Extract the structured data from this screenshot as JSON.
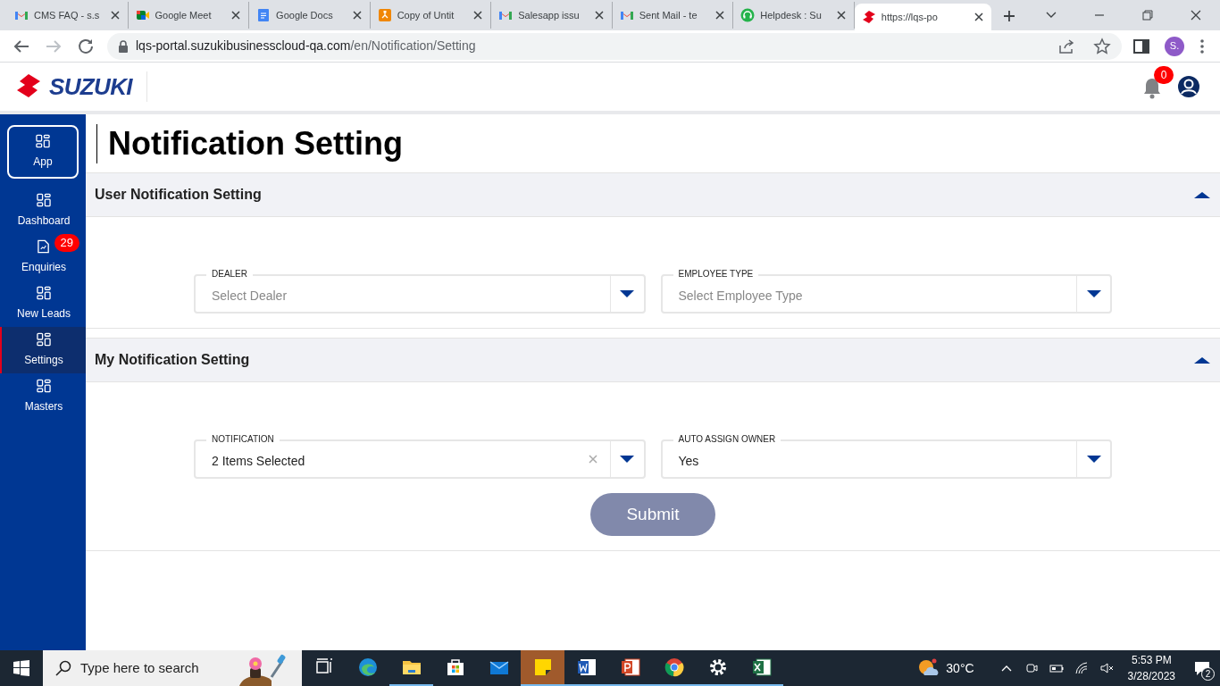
{
  "browser": {
    "tabs": [
      {
        "label": "CMS FAQ - s.s",
        "selected": false
      },
      {
        "label": "Google Meet",
        "selected": false
      },
      {
        "label": "Google Docs",
        "selected": false
      },
      {
        "label": "Copy of Untit",
        "selected": false
      },
      {
        "label": "Salesapp issu",
        "selected": false
      },
      {
        "label": "Sent Mail - te",
        "selected": false
      },
      {
        "label": "Helpdesk : Su",
        "selected": false
      },
      {
        "label": "https://lqs-po",
        "selected": true
      }
    ],
    "url_host": "lqs-portal.suzukibusinesscloud-qa.com",
    "url_path": "/en/Notification/Setting",
    "profile": "S."
  },
  "header": {
    "logo": "SUZUKI",
    "notification_count": "0"
  },
  "sidebar": {
    "items": [
      {
        "label": "App",
        "kind": "boxed",
        "selected": false
      },
      {
        "label": "Dashboard",
        "kind": "link",
        "selected": false
      },
      {
        "label": "Enquiries",
        "kind": "link",
        "selected": false,
        "badge": "29"
      },
      {
        "label": "New Leads",
        "kind": "link",
        "selected": false
      },
      {
        "label": "Settings",
        "kind": "link",
        "selected": true
      },
      {
        "label": "Masters",
        "kind": "link",
        "selected": false
      }
    ]
  },
  "page_title": "Notification Setting",
  "sections": [
    {
      "title": "User Notification Setting",
      "expanded": true,
      "fields": [
        {
          "label": "DEALER",
          "placeholder": "Select Dealer",
          "clearable": false
        },
        {
          "label": "EMPLOYEE TYPE",
          "placeholder": "Select Employee Type",
          "clearable": false
        }
      ]
    },
    {
      "title": "My Notification Setting",
      "expanded": true,
      "fields": [
        {
          "label": "NOTIFICATION",
          "value": "2 Items Selected",
          "clearable": true
        },
        {
          "label": "AUTO ASSIGN OWNER",
          "value": "Yes",
          "clearable": false
        }
      ],
      "submit": {
        "label": "Submit",
        "disabled": true
      }
    }
  ],
  "taskbar": {
    "search_placeholder": "Type here to search",
    "apps": [
      {
        "kind": "taskview",
        "running": false,
        "focused": false
      },
      {
        "kind": "edge",
        "running": false,
        "focused": false
      },
      {
        "kind": "explorer",
        "running": true,
        "focused": false
      },
      {
        "kind": "store",
        "running": false,
        "focused": false
      },
      {
        "kind": "mail",
        "running": false,
        "focused": false
      },
      {
        "kind": "sticky",
        "running": true,
        "focused": true
      },
      {
        "kind": "word",
        "running": true,
        "focused": false
      },
      {
        "kind": "powerpoint",
        "running": true,
        "focused": false
      },
      {
        "kind": "chrome",
        "running": true,
        "focused": false
      },
      {
        "kind": "settings",
        "running": true,
        "focused": false
      },
      {
        "kind": "excel",
        "running": true,
        "focused": false
      }
    ],
    "temperature": "30°C",
    "time": "5:53 PM",
    "date": "3/28/2023",
    "notifications": "2"
  }
}
